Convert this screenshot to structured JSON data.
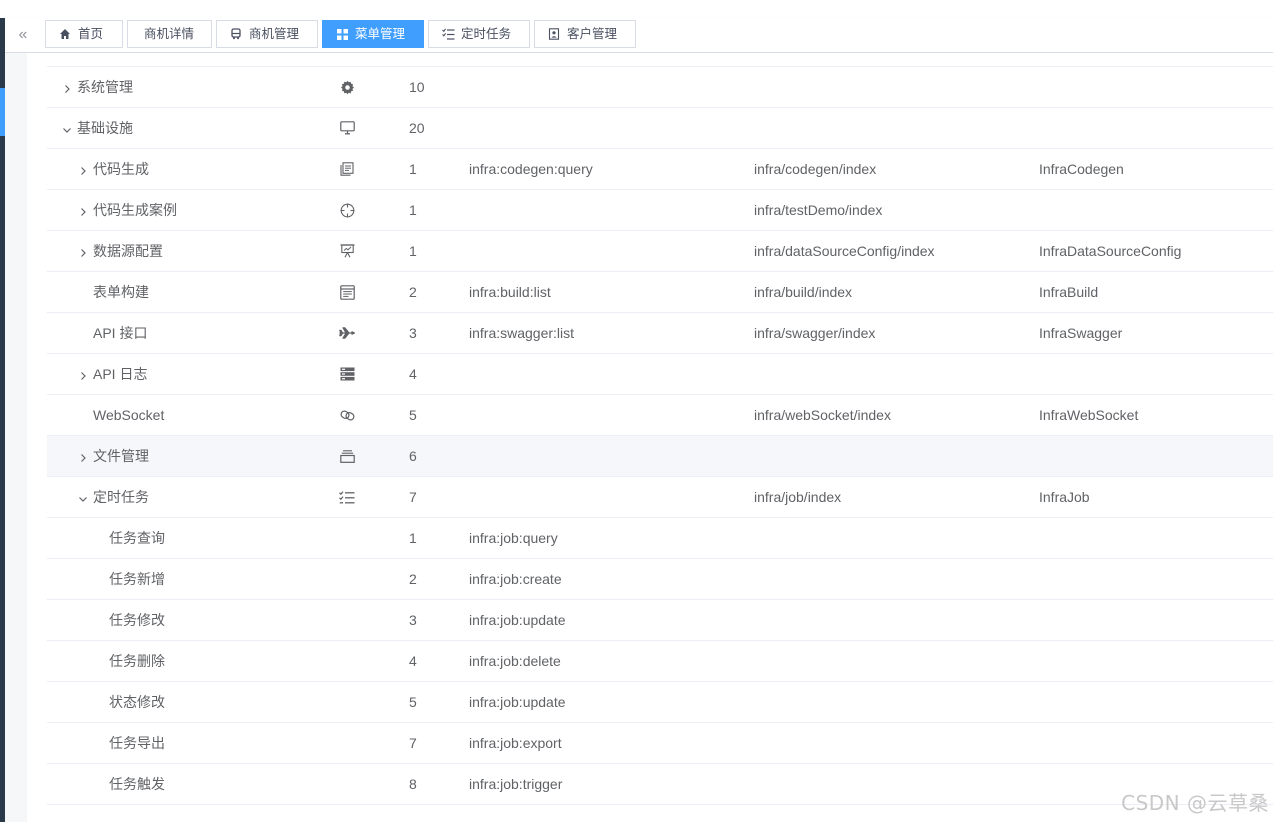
{
  "tabs": [
    {
      "label": "首页",
      "icon": "home-icon",
      "active": false
    },
    {
      "label": "商机详情",
      "icon": "",
      "active": false
    },
    {
      "label": "商机管理",
      "icon": "bus-icon",
      "active": false
    },
    {
      "label": "菜单管理",
      "icon": "grid-icon",
      "active": true
    },
    {
      "label": "定时任务",
      "icon": "checklist-icon",
      "active": false
    },
    {
      "label": "客户管理",
      "icon": "contact-icon",
      "active": false
    }
  ],
  "rows": [
    {
      "name": "系统管理",
      "level": 0,
      "expand": "collapsed",
      "icon": "gear-icon",
      "sort": "10",
      "perm": "",
      "path": "",
      "component": ""
    },
    {
      "name": "基础设施",
      "level": 0,
      "expand": "expanded",
      "icon": "monitor-icon",
      "sort": "20",
      "perm": "",
      "path": "",
      "component": ""
    },
    {
      "name": "代码生成",
      "level": 1,
      "expand": "collapsed",
      "icon": "code-doc-icon",
      "sort": "1",
      "perm": "infra:codegen:query",
      "path": "infra/codegen/index",
      "component": "InfraCodegen"
    },
    {
      "name": "代码生成案例",
      "level": 1,
      "expand": "collapsed",
      "icon": "crosshair-icon",
      "sort": "1",
      "perm": "",
      "path": "infra/testDemo/index",
      "component": ""
    },
    {
      "name": "数据源配置",
      "level": 1,
      "expand": "collapsed",
      "icon": "presentation-icon",
      "sort": "1",
      "perm": "",
      "path": "infra/dataSourceConfig/index",
      "component": "InfraDataSourceConfig"
    },
    {
      "name": "表单构建",
      "level": 1,
      "expand": "none",
      "icon": "form-icon",
      "sort": "2",
      "perm": "infra:build:list",
      "path": "infra/build/index",
      "component": "InfraBuild"
    },
    {
      "name": "API 接口",
      "level": 1,
      "expand": "none",
      "icon": "plane-icon",
      "sort": "3",
      "perm": "infra:swagger:list",
      "path": "infra/swagger/index",
      "component": "InfraSwagger"
    },
    {
      "name": "API 日志",
      "level": 1,
      "expand": "collapsed",
      "icon": "log-icon",
      "sort": "4",
      "perm": "",
      "path": "",
      "component": ""
    },
    {
      "name": "WebSocket",
      "level": 1,
      "expand": "none",
      "icon": "link-icon",
      "sort": "5",
      "perm": "",
      "path": "infra/webSocket/index",
      "component": "InfraWebSocket"
    },
    {
      "name": "文件管理",
      "level": 1,
      "expand": "collapsed",
      "icon": "archive-icon",
      "sort": "6",
      "perm": "",
      "path": "",
      "component": ""
    },
    {
      "name": "定时任务",
      "level": 1,
      "expand": "expanded",
      "icon": "checklist-icon",
      "sort": "7",
      "perm": "",
      "path": "infra/job/index",
      "component": "InfraJob"
    },
    {
      "name": "任务查询",
      "level": 2,
      "expand": "none",
      "icon": "",
      "sort": "1",
      "perm": "infra:job:query",
      "path": "",
      "component": ""
    },
    {
      "name": "任务新增",
      "level": 2,
      "expand": "none",
      "icon": "",
      "sort": "2",
      "perm": "infra:job:create",
      "path": "",
      "component": ""
    },
    {
      "name": "任务修改",
      "level": 2,
      "expand": "none",
      "icon": "",
      "sort": "3",
      "perm": "infra:job:update",
      "path": "",
      "component": ""
    },
    {
      "name": "任务删除",
      "level": 2,
      "expand": "none",
      "icon": "",
      "sort": "4",
      "perm": "infra:job:delete",
      "path": "",
      "component": ""
    },
    {
      "name": "状态修改",
      "level": 2,
      "expand": "none",
      "icon": "",
      "sort": "5",
      "perm": "infra:job:update",
      "path": "",
      "component": ""
    },
    {
      "name": "任务导出",
      "level": 2,
      "expand": "none",
      "icon": "",
      "sort": "7",
      "perm": "infra:job:export",
      "path": "",
      "component": ""
    },
    {
      "name": "任务触发",
      "level": 2,
      "expand": "none",
      "icon": "",
      "sort": "8",
      "perm": "infra:job:trigger",
      "path": "",
      "component": ""
    }
  ],
  "watermark": "CSDN @云草桑",
  "colors": {
    "accent": "#409eff",
    "sidebar": "#2b3a4a",
    "text": "#606266"
  }
}
